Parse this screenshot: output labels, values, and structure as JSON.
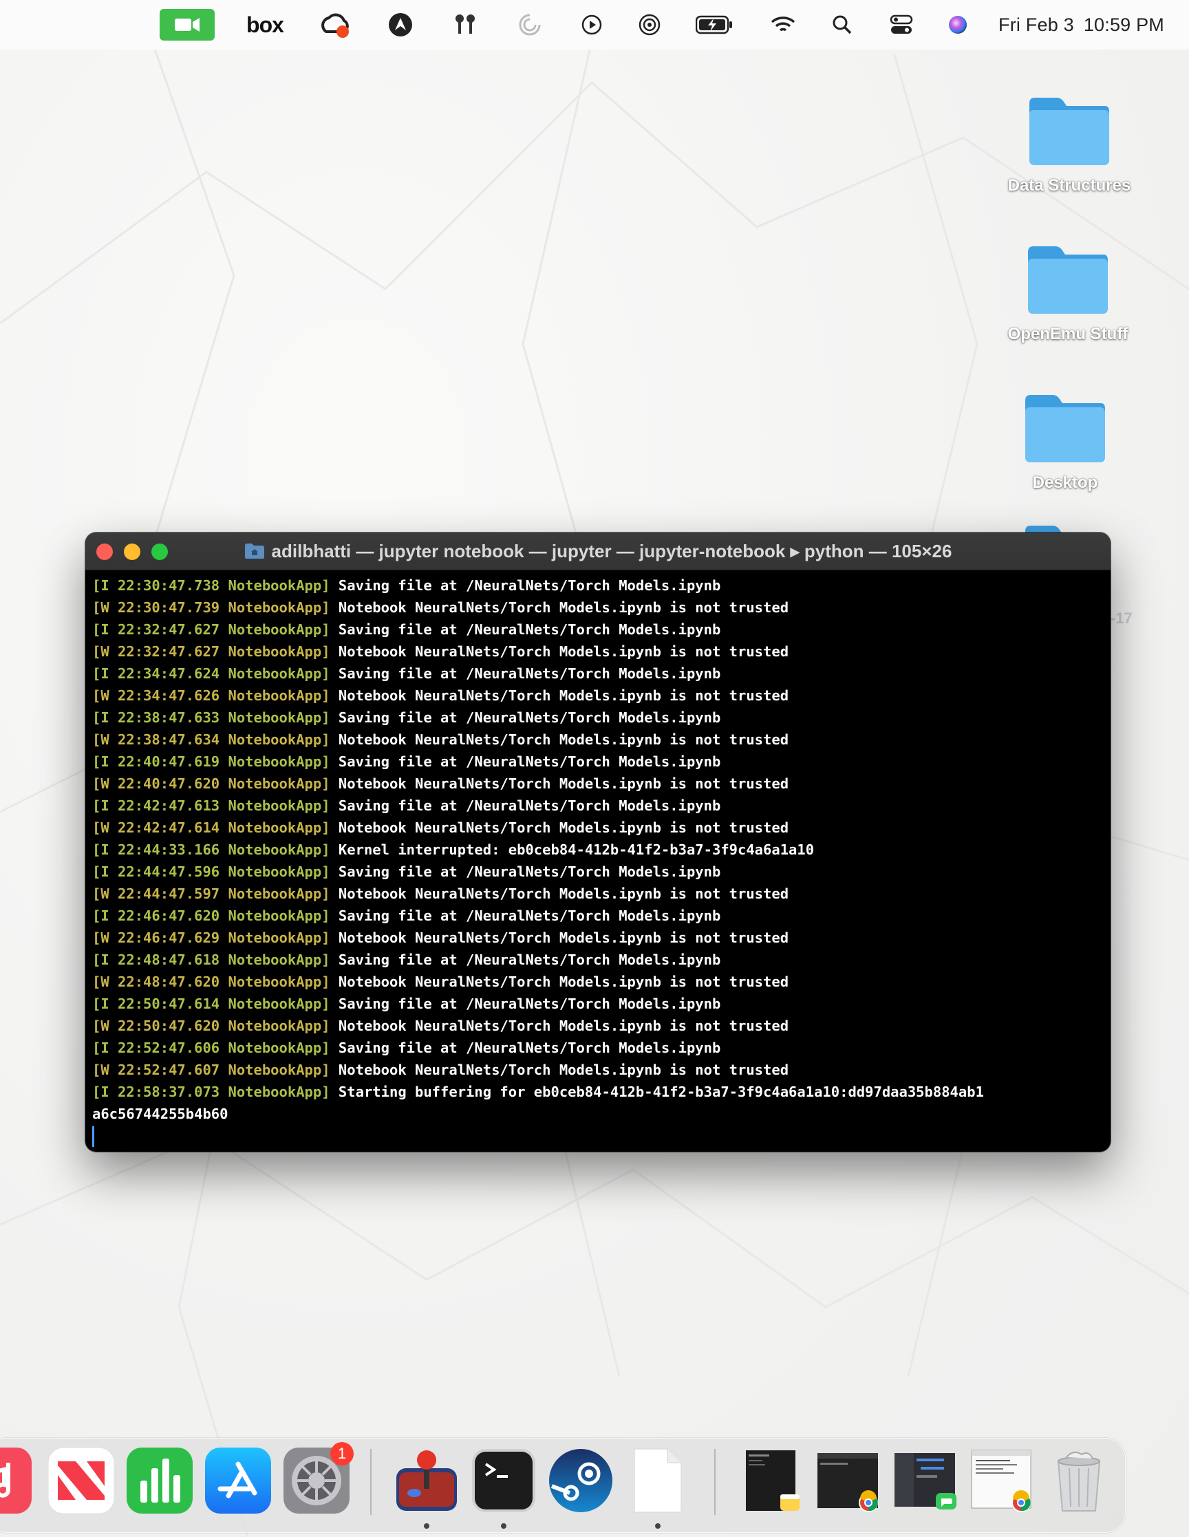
{
  "menubar": {
    "date": "Fri Feb 3",
    "time": "10:59 PM",
    "status_icons": [
      "facetime-icon",
      "box-icon",
      "creative-cloud-icon",
      "vpn-icon",
      "airpods-icon",
      "focus-icon",
      "now-playing-icon",
      "airdrop-icon",
      "battery-icon",
      "wifi-icon",
      "spotlight-icon",
      "control-center-icon",
      "siri-icon"
    ],
    "box_label": "box"
  },
  "desktop": {
    "folders": [
      {
        "label": "Data Structures"
      },
      {
        "label": "OpenEmu Stuff"
      },
      {
        "label": "Desktop"
      }
    ],
    "peek_label": "-17"
  },
  "terminal": {
    "title": "adilbhatti — jupyter notebook — jupyter — jupyter-notebook ▸ python — 105×26",
    "lines": [
      {
        "tag": "[I 22:30:47.738 NotebookApp]",
        "level": "I",
        "msg": "Saving file at /NeuralNets/Torch Models.ipynb"
      },
      {
        "tag": "[W 22:30:47.739 NotebookApp]",
        "level": "W",
        "msg": "Notebook NeuralNets/Torch Models.ipynb is not trusted"
      },
      {
        "tag": "[I 22:32:47.627 NotebookApp]",
        "level": "I",
        "msg": "Saving file at /NeuralNets/Torch Models.ipynb"
      },
      {
        "tag": "[W 22:32:47.627 NotebookApp]",
        "level": "W",
        "msg": "Notebook NeuralNets/Torch Models.ipynb is not trusted"
      },
      {
        "tag": "[I 22:34:47.624 NotebookApp]",
        "level": "I",
        "msg": "Saving file at /NeuralNets/Torch Models.ipynb"
      },
      {
        "tag": "[W 22:34:47.626 NotebookApp]",
        "level": "W",
        "msg": "Notebook NeuralNets/Torch Models.ipynb is not trusted"
      },
      {
        "tag": "[I 22:38:47.633 NotebookApp]",
        "level": "I",
        "msg": "Saving file at /NeuralNets/Torch Models.ipynb"
      },
      {
        "tag": "[W 22:38:47.634 NotebookApp]",
        "level": "W",
        "msg": "Notebook NeuralNets/Torch Models.ipynb is not trusted"
      },
      {
        "tag": "[I 22:40:47.619 NotebookApp]",
        "level": "I",
        "msg": "Saving file at /NeuralNets/Torch Models.ipynb"
      },
      {
        "tag": "[W 22:40:47.620 NotebookApp]",
        "level": "W",
        "msg": "Notebook NeuralNets/Torch Models.ipynb is not trusted"
      },
      {
        "tag": "[I 22:42:47.613 NotebookApp]",
        "level": "I",
        "msg": "Saving file at /NeuralNets/Torch Models.ipynb"
      },
      {
        "tag": "[W 22:42:47.614 NotebookApp]",
        "level": "W",
        "msg": "Notebook NeuralNets/Torch Models.ipynb is not trusted"
      },
      {
        "tag": "[I 22:44:33.166 NotebookApp]",
        "level": "I",
        "msg": "Kernel interrupted: eb0ceb84-412b-41f2-b3a7-3f9c4a6a1a10"
      },
      {
        "tag": "[I 22:44:47.596 NotebookApp]",
        "level": "I",
        "msg": "Saving file at /NeuralNets/Torch Models.ipynb"
      },
      {
        "tag": "[W 22:44:47.597 NotebookApp]",
        "level": "W",
        "msg": "Notebook NeuralNets/Torch Models.ipynb is not trusted"
      },
      {
        "tag": "[I 22:46:47.620 NotebookApp]",
        "level": "I",
        "msg": "Saving file at /NeuralNets/Torch Models.ipynb"
      },
      {
        "tag": "[W 22:46:47.629 NotebookApp]",
        "level": "W",
        "msg": "Notebook NeuralNets/Torch Models.ipynb is not trusted"
      },
      {
        "tag": "[I 22:48:47.618 NotebookApp]",
        "level": "I",
        "msg": "Saving file at /NeuralNets/Torch Models.ipynb"
      },
      {
        "tag": "[W 22:48:47.620 NotebookApp]",
        "level": "W",
        "msg": "Notebook NeuralNets/Torch Models.ipynb is not trusted"
      },
      {
        "tag": "[I 22:50:47.614 NotebookApp]",
        "level": "I",
        "msg": "Saving file at /NeuralNets/Torch Models.ipynb"
      },
      {
        "tag": "[W 22:50:47.620 NotebookApp]",
        "level": "W",
        "msg": "Notebook NeuralNets/Torch Models.ipynb is not trusted"
      },
      {
        "tag": "[I 22:52:47.606 NotebookApp]",
        "level": "I",
        "msg": "Saving file at /NeuralNets/Torch Models.ipynb"
      },
      {
        "tag": "[W 22:52:47.607 NotebookApp]",
        "level": "W",
        "msg": "Notebook NeuralNets/Torch Models.ipynb is not trusted"
      },
      {
        "tag": "[I 22:58:37.073 NotebookApp]",
        "level": "I",
        "msg": "Starting buffering for eb0ceb84-412b-41f2-b3a7-3f9c4a6a1a10:dd97daa35b884ab1"
      },
      {
        "tag": "",
        "level": "",
        "msg": "a6c56744255b4b60"
      }
    ]
  },
  "dock": {
    "apps": [
      {
        "name": "music-icon"
      },
      {
        "name": "news-icon"
      },
      {
        "name": "numbers-icon"
      },
      {
        "name": "app-store-icon"
      },
      {
        "name": "system-settings-icon",
        "badge": "1"
      },
      {
        "name": "joystick-app-icon"
      },
      {
        "name": "terminal-icon"
      },
      {
        "name": "steam-icon"
      },
      {
        "name": "document-icon"
      },
      {
        "name": "notes-window-thumbnail"
      },
      {
        "name": "chrome-window-thumbnail"
      },
      {
        "name": "messages-window-thumbnail"
      },
      {
        "name": "chrome-document-thumbnail"
      },
      {
        "name": "trash-icon"
      }
    ]
  },
  "colors": {
    "close": "#fe5f57",
    "minimize": "#febc2e",
    "maximize": "#28c840",
    "info_tag": "#a9c04a",
    "warn_tag": "#c6b449",
    "folder": "#5fb8f0",
    "facetime_green": "#3fbe4c"
  }
}
